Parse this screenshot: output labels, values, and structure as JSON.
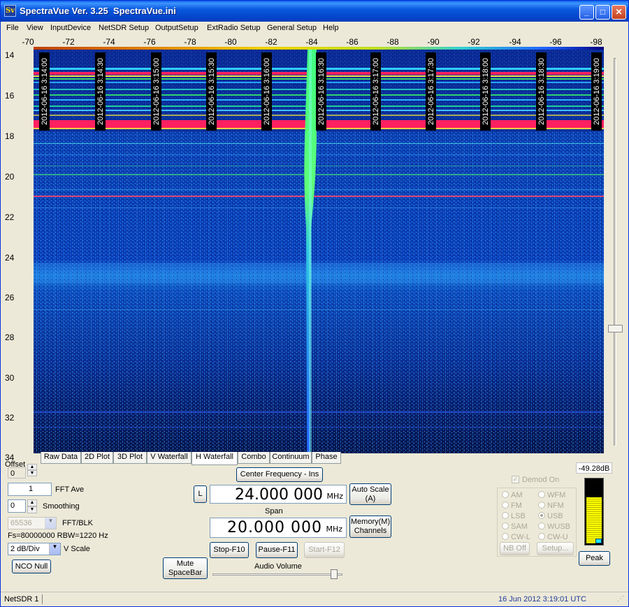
{
  "window": {
    "title": "SpectraVue Ver. 3.25  SpectraVue.ini",
    "icon_label": "Sv"
  },
  "menu": [
    "File",
    "View",
    "InputDevice",
    "NetSDR Setup",
    "OutputSetup",
    "ExtRadio Setup",
    "General Setup",
    "Help"
  ],
  "freq_scale": {
    "ticks": [
      "-70",
      "-72",
      "-74",
      "-76",
      "-78",
      "-80",
      "-82",
      "-84",
      "-86",
      "-88",
      "-90",
      "-92",
      "-94",
      "-96",
      "-98"
    ]
  },
  "y_scale": {
    "ticks": [
      "14",
      "16",
      "18",
      "20",
      "22",
      "24",
      "26",
      "28",
      "30",
      "32",
      "34"
    ]
  },
  "timestamps": [
    "2012-06-16 3:14:00",
    "2012-06-16 3:14:30",
    "2012-06-16 3:15:00",
    "2012-06-16 3:15:30",
    "2012-06-16 3:16:00",
    "2012-06-16 3:16:30",
    "2012-06-16 3:17:00",
    "2012-06-16 3:17:30",
    "2012-06-16 3:18:00",
    "2012-06-16 3:18:30",
    "2012-06-16 3:19:00"
  ],
  "tabs": [
    "Raw Data",
    "2D Plot",
    "3D Plot",
    "V Waterfall",
    "H Waterfall",
    "Combo",
    "Continuum",
    "Phase"
  ],
  "active_tab": "H Waterfall",
  "controls": {
    "offset_label": "Offset",
    "offset_value": "0",
    "fft_ave_value": "1",
    "fft_ave_label": "FFT Ave",
    "smoothing_value": "0",
    "smoothing_label": "Smoothing",
    "fft_blk_value": "65536",
    "fft_blk_label": "FFT/BLK",
    "fs_info": "Fs=80000000 RBW=1220 Hz",
    "vscale_value": "2 dB/Div",
    "vscale_label": "V Scale",
    "nco_null": "NCO Null"
  },
  "center": {
    "center_freq_button": "Center Frequency - Ins",
    "l_button": "L",
    "freq_value": "24.000 000",
    "freq_unit": "MHz",
    "auto_scale_button": "Auto Scale (A)",
    "span_label": "Span",
    "span_value": "20.000 000",
    "span_unit": "MHz",
    "memory_button": "Memory(M) Channels",
    "stop_button": "Stop-F10",
    "pause_button": "Pause-F11",
    "start_button": "Start-F12",
    "mute_button": "Mute SpaceBar",
    "audio_volume_label": "Audio Volume"
  },
  "demod": {
    "label": "Demod On",
    "modes_left": [
      "AM",
      "FM",
      "LSB",
      "SAM",
      "CW-L"
    ],
    "modes_right": [
      "WFM",
      "NFM",
      "USB",
      "WUSB",
      "CW-U"
    ],
    "selected": "USB",
    "nb_off": "NB Off",
    "setup": "Setup..."
  },
  "meter": {
    "value": "-49.28dB",
    "peak_button": "Peak",
    "level_fraction": 0.72
  },
  "status": {
    "left": "NetSDR 1",
    "datetime": "16 Jun 2012  3:19:01 UTC"
  },
  "colors": {
    "waterfall_bg": "#0a1f7a",
    "hot_band": "#ff2060",
    "signal": "#40ff80"
  }
}
